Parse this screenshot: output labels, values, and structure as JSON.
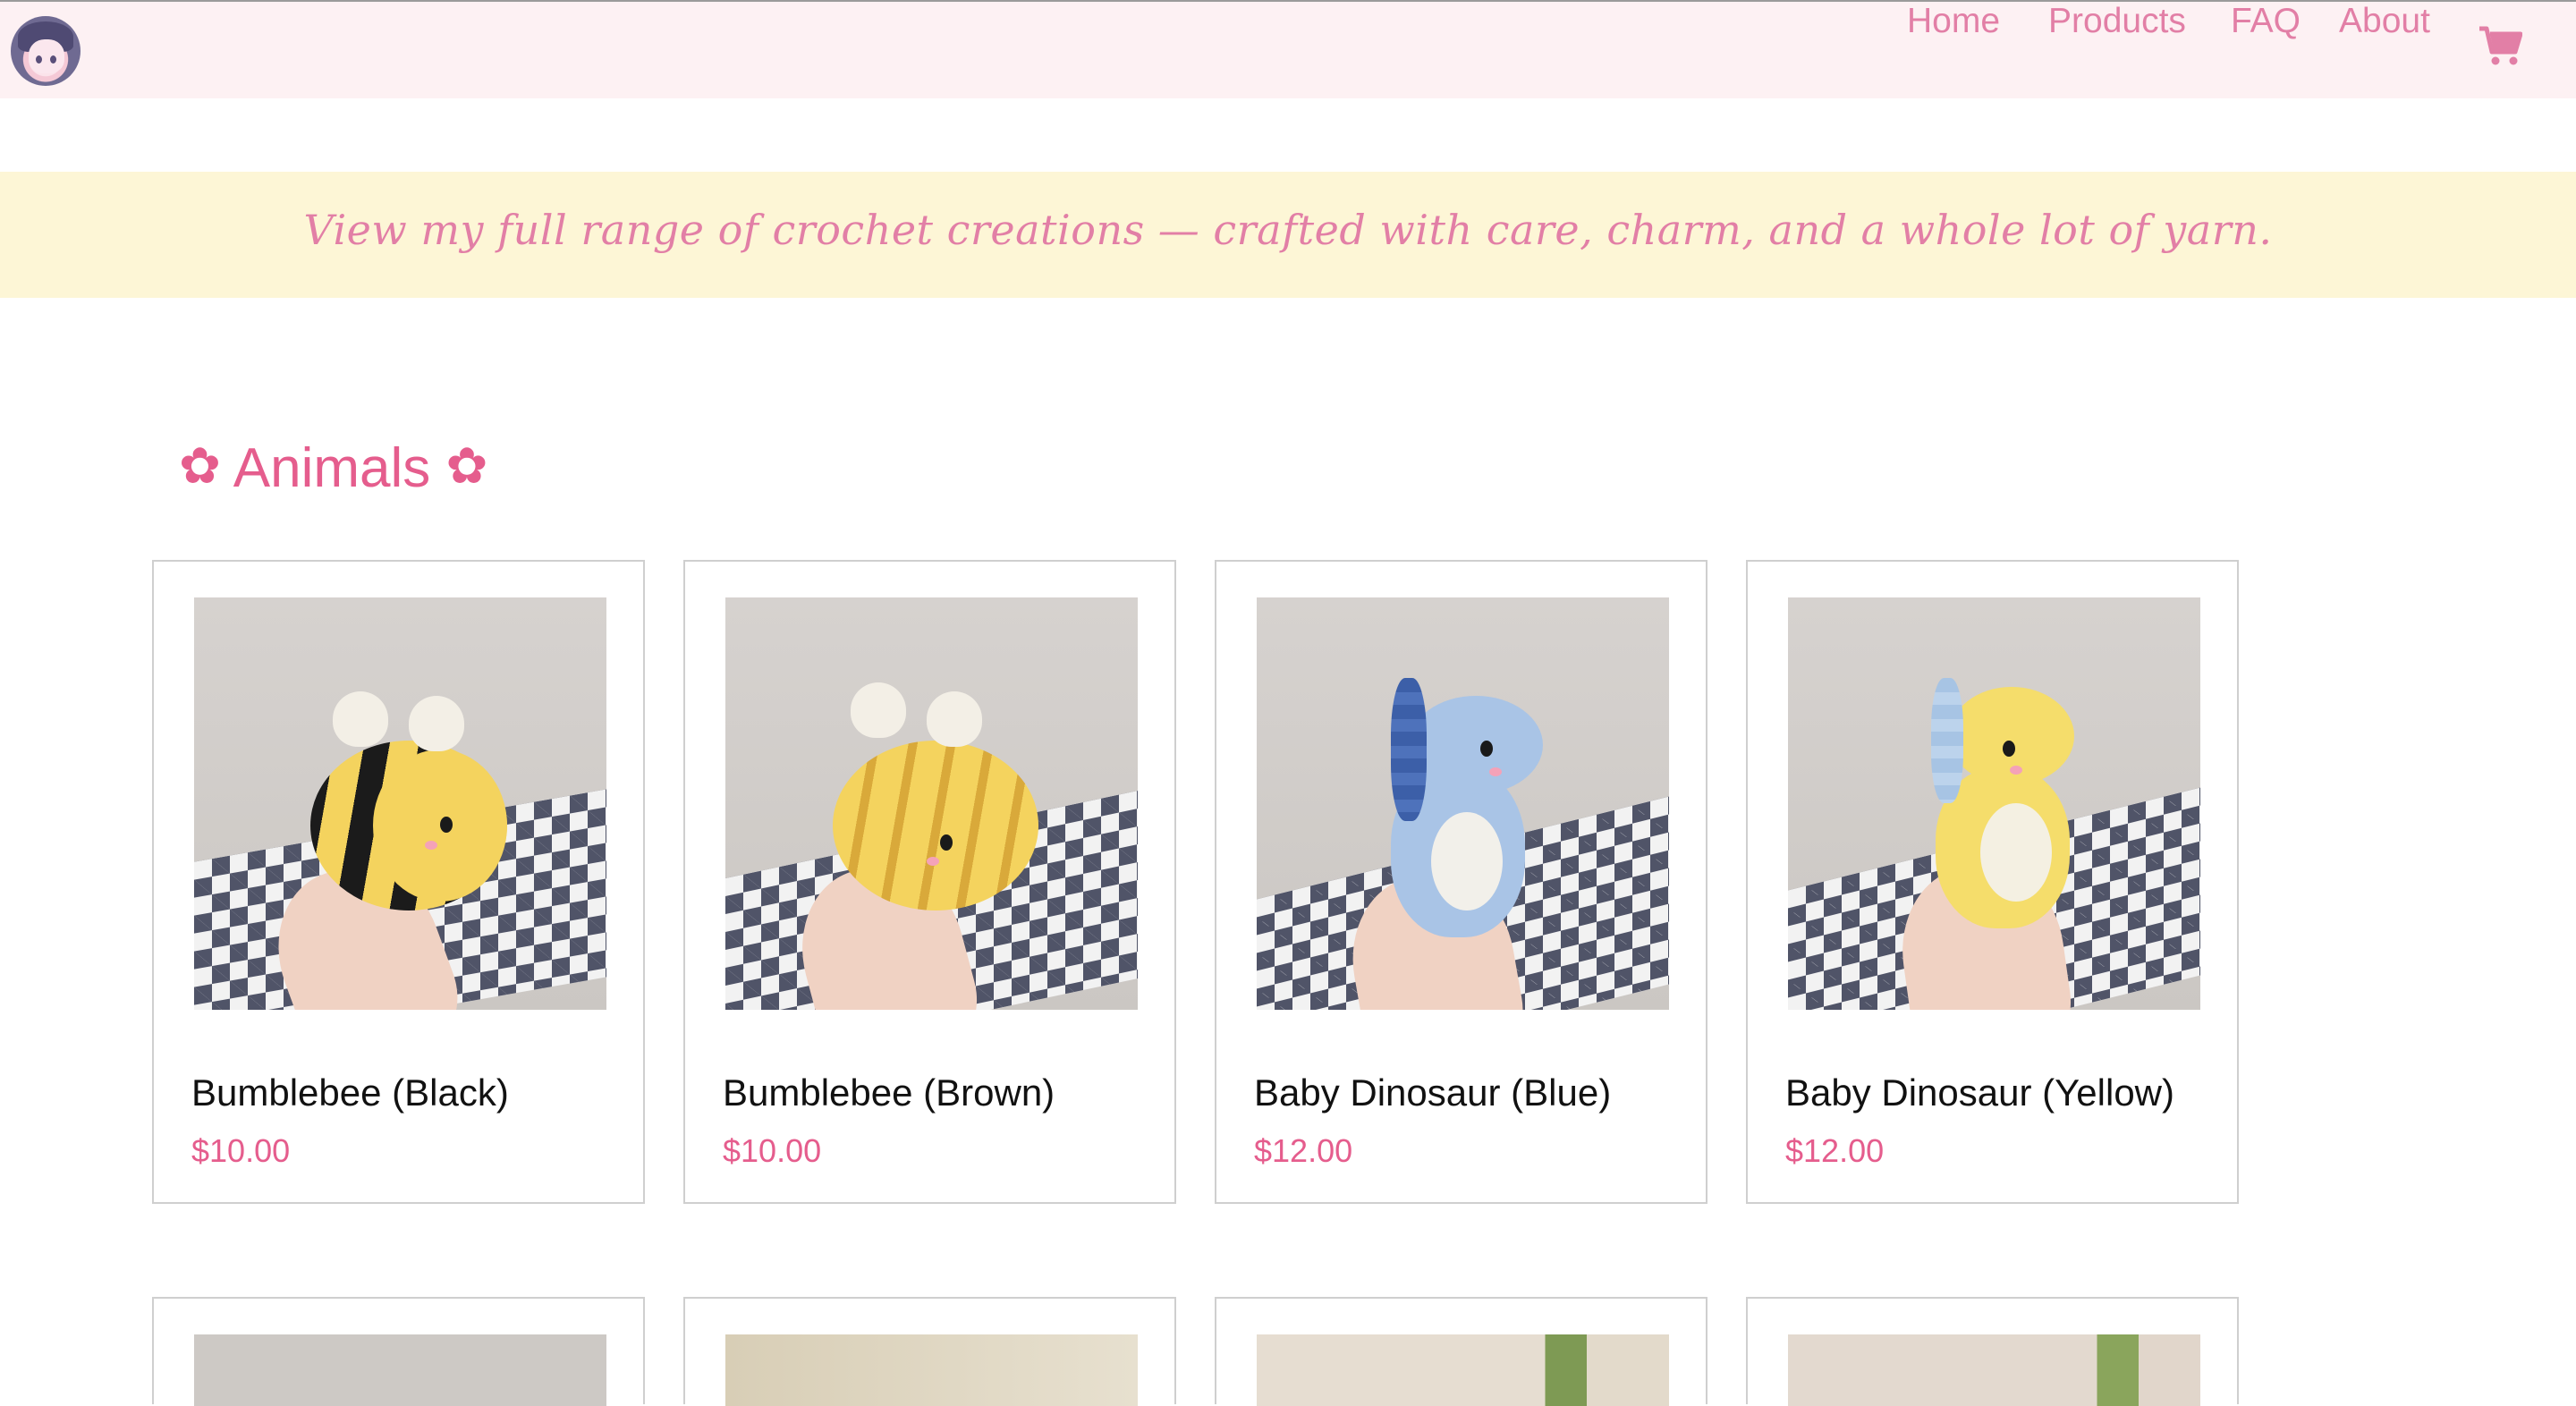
{
  "nav": {
    "links": [
      "Home",
      "Products",
      "FAQ",
      "About"
    ],
    "cart_icon": "shopping-cart-icon",
    "logo_icon": "avatar-logo"
  },
  "banner": {
    "text": "View my full range of crochet creations — crafted with care, charm, and a whole lot of yarn."
  },
  "section": {
    "title": "Animals",
    "decoration_icon": "flower-icon"
  },
  "products": [
    {
      "name": "Bumblebee (Black)",
      "price": "$10.00"
    },
    {
      "name": "Bumblebee (Brown)",
      "price": "$10.00"
    },
    {
      "name": "Baby Dinosaur (Blue)",
      "price": "$12.00"
    },
    {
      "name": "Baby Dinosaur (Yellow)",
      "price": "$12.00"
    }
  ],
  "colors": {
    "accent_pink": "#e55d8d",
    "nav_pink": "#e27fa6",
    "nav_bg": "#fdf1f3",
    "banner_bg": "#fdf6d6"
  }
}
